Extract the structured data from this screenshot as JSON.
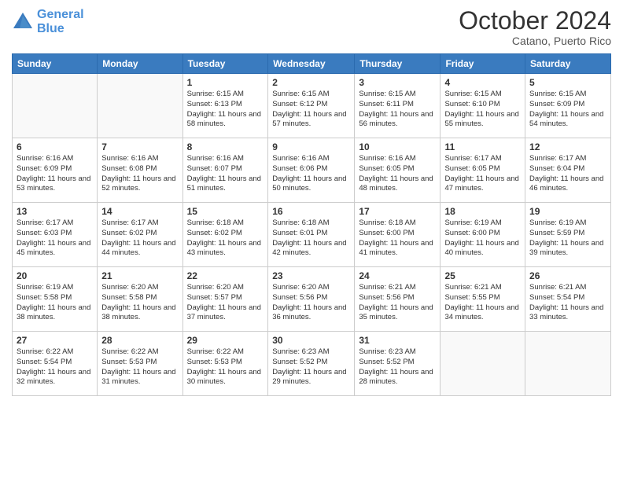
{
  "header": {
    "logo_line1": "General",
    "logo_line2": "Blue",
    "month": "October 2024",
    "location": "Catano, Puerto Rico"
  },
  "days_of_week": [
    "Sunday",
    "Monday",
    "Tuesday",
    "Wednesday",
    "Thursday",
    "Friday",
    "Saturday"
  ],
  "weeks": [
    [
      {
        "day": "",
        "info": ""
      },
      {
        "day": "",
        "info": ""
      },
      {
        "day": "1",
        "info": "Sunrise: 6:15 AM\nSunset: 6:13 PM\nDaylight: 11 hours and 58 minutes."
      },
      {
        "day": "2",
        "info": "Sunrise: 6:15 AM\nSunset: 6:12 PM\nDaylight: 11 hours and 57 minutes."
      },
      {
        "day": "3",
        "info": "Sunrise: 6:15 AM\nSunset: 6:11 PM\nDaylight: 11 hours and 56 minutes."
      },
      {
        "day": "4",
        "info": "Sunrise: 6:15 AM\nSunset: 6:10 PM\nDaylight: 11 hours and 55 minutes."
      },
      {
        "day": "5",
        "info": "Sunrise: 6:15 AM\nSunset: 6:09 PM\nDaylight: 11 hours and 54 minutes."
      }
    ],
    [
      {
        "day": "6",
        "info": "Sunrise: 6:16 AM\nSunset: 6:09 PM\nDaylight: 11 hours and 53 minutes."
      },
      {
        "day": "7",
        "info": "Sunrise: 6:16 AM\nSunset: 6:08 PM\nDaylight: 11 hours and 52 minutes."
      },
      {
        "day": "8",
        "info": "Sunrise: 6:16 AM\nSunset: 6:07 PM\nDaylight: 11 hours and 51 minutes."
      },
      {
        "day": "9",
        "info": "Sunrise: 6:16 AM\nSunset: 6:06 PM\nDaylight: 11 hours and 50 minutes."
      },
      {
        "day": "10",
        "info": "Sunrise: 6:16 AM\nSunset: 6:05 PM\nDaylight: 11 hours and 48 minutes."
      },
      {
        "day": "11",
        "info": "Sunrise: 6:17 AM\nSunset: 6:05 PM\nDaylight: 11 hours and 47 minutes."
      },
      {
        "day": "12",
        "info": "Sunrise: 6:17 AM\nSunset: 6:04 PM\nDaylight: 11 hours and 46 minutes."
      }
    ],
    [
      {
        "day": "13",
        "info": "Sunrise: 6:17 AM\nSunset: 6:03 PM\nDaylight: 11 hours and 45 minutes."
      },
      {
        "day": "14",
        "info": "Sunrise: 6:17 AM\nSunset: 6:02 PM\nDaylight: 11 hours and 44 minutes."
      },
      {
        "day": "15",
        "info": "Sunrise: 6:18 AM\nSunset: 6:02 PM\nDaylight: 11 hours and 43 minutes."
      },
      {
        "day": "16",
        "info": "Sunrise: 6:18 AM\nSunset: 6:01 PM\nDaylight: 11 hours and 42 minutes."
      },
      {
        "day": "17",
        "info": "Sunrise: 6:18 AM\nSunset: 6:00 PM\nDaylight: 11 hours and 41 minutes."
      },
      {
        "day": "18",
        "info": "Sunrise: 6:19 AM\nSunset: 6:00 PM\nDaylight: 11 hours and 40 minutes."
      },
      {
        "day": "19",
        "info": "Sunrise: 6:19 AM\nSunset: 5:59 PM\nDaylight: 11 hours and 39 minutes."
      }
    ],
    [
      {
        "day": "20",
        "info": "Sunrise: 6:19 AM\nSunset: 5:58 PM\nDaylight: 11 hours and 38 minutes."
      },
      {
        "day": "21",
        "info": "Sunrise: 6:20 AM\nSunset: 5:58 PM\nDaylight: 11 hours and 38 minutes."
      },
      {
        "day": "22",
        "info": "Sunrise: 6:20 AM\nSunset: 5:57 PM\nDaylight: 11 hours and 37 minutes."
      },
      {
        "day": "23",
        "info": "Sunrise: 6:20 AM\nSunset: 5:56 PM\nDaylight: 11 hours and 36 minutes."
      },
      {
        "day": "24",
        "info": "Sunrise: 6:21 AM\nSunset: 5:56 PM\nDaylight: 11 hours and 35 minutes."
      },
      {
        "day": "25",
        "info": "Sunrise: 6:21 AM\nSunset: 5:55 PM\nDaylight: 11 hours and 34 minutes."
      },
      {
        "day": "26",
        "info": "Sunrise: 6:21 AM\nSunset: 5:54 PM\nDaylight: 11 hours and 33 minutes."
      }
    ],
    [
      {
        "day": "27",
        "info": "Sunrise: 6:22 AM\nSunset: 5:54 PM\nDaylight: 11 hours and 32 minutes."
      },
      {
        "day": "28",
        "info": "Sunrise: 6:22 AM\nSunset: 5:53 PM\nDaylight: 11 hours and 31 minutes."
      },
      {
        "day": "29",
        "info": "Sunrise: 6:22 AM\nSunset: 5:53 PM\nDaylight: 11 hours and 30 minutes."
      },
      {
        "day": "30",
        "info": "Sunrise: 6:23 AM\nSunset: 5:52 PM\nDaylight: 11 hours and 29 minutes."
      },
      {
        "day": "31",
        "info": "Sunrise: 6:23 AM\nSunset: 5:52 PM\nDaylight: 11 hours and 28 minutes."
      },
      {
        "day": "",
        "info": ""
      },
      {
        "day": "",
        "info": ""
      }
    ]
  ]
}
